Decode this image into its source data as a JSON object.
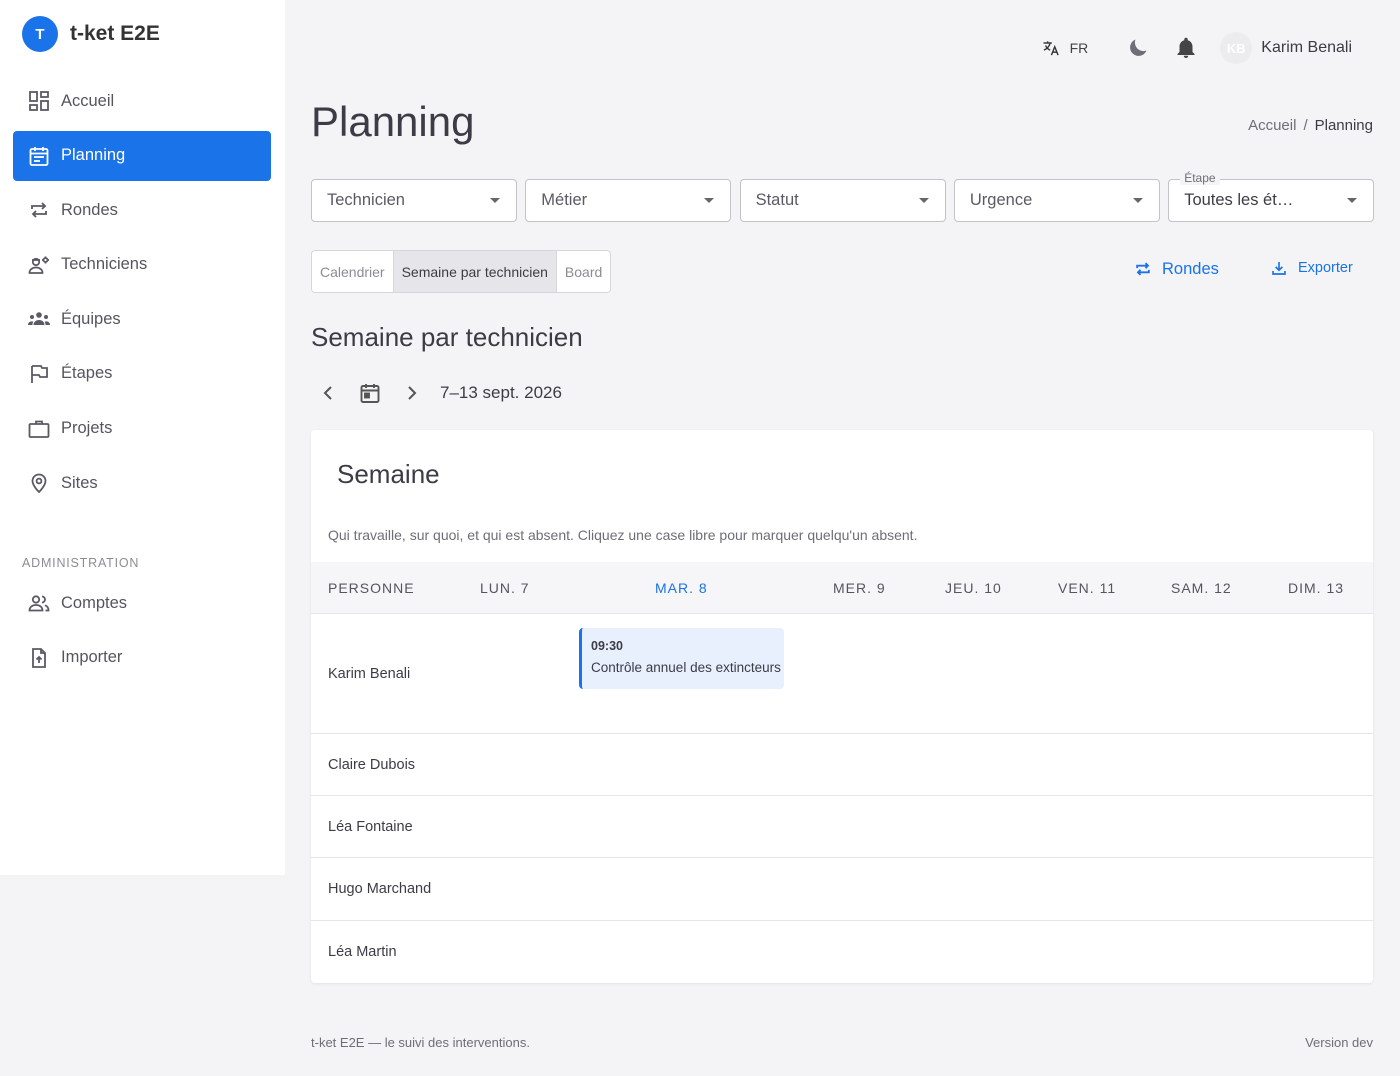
{
  "app": {
    "logo_letter": "T",
    "name": "t-ket E2E"
  },
  "sidebar": {
    "items": [
      {
        "label": "Accueil",
        "icon": "dashboard-icon"
      },
      {
        "label": "Planning",
        "icon": "calendar-icon",
        "active": true
      },
      {
        "label": "Rondes",
        "icon": "repeat-icon"
      },
      {
        "label": "Techniciens",
        "icon": "engineer-icon"
      },
      {
        "label": "Équipes",
        "icon": "groups-icon"
      },
      {
        "label": "Étapes",
        "icon": "flag-icon"
      },
      {
        "label": "Projets",
        "icon": "briefcase-icon"
      },
      {
        "label": "Sites",
        "icon": "location-pin-icon"
      }
    ],
    "admin_section": "ADMINISTRATION",
    "admin_items": [
      {
        "label": "Comptes",
        "icon": "people-icon"
      },
      {
        "label": "Importer",
        "icon": "file-upload-icon"
      }
    ]
  },
  "topbar": {
    "language": "FR",
    "user": {
      "initials": "KB",
      "name": "Karim Benali"
    }
  },
  "page": {
    "title": "Planning",
    "breadcrumb": [
      "Accueil",
      "Planning"
    ]
  },
  "filters": [
    {
      "label": "Technicien"
    },
    {
      "label": "Métier"
    },
    {
      "label": "Statut"
    },
    {
      "label": "Urgence"
    },
    {
      "label": "Étape",
      "value": "Toutes les ét…"
    }
  ],
  "views": [
    {
      "label": "Calendrier"
    },
    {
      "label": "Semaine par technicien",
      "active": true
    },
    {
      "label": "Board"
    }
  ],
  "actions": {
    "rondes": "Rondes",
    "export": "Exporter"
  },
  "section_title": "Semaine par technicien",
  "week": {
    "range": "7–13 sept. 2026"
  },
  "card": {
    "title": "Semaine",
    "subtitle": "Qui travaille, sur quoi, et qui est absent. Cliquez une case libre pour marquer quelqu'un absent.",
    "columns": [
      "PERSONNE",
      "LUN. 7",
      "MAR. 8",
      "MER. 9",
      "JEU. 10",
      "VEN. 11",
      "SAM. 12",
      "DIM. 13"
    ],
    "today_column": "MAR. 8",
    "rows": [
      {
        "name": "Karim Benali",
        "event": {
          "time": "09:30",
          "title": "Contrôle annuel des extincteurs",
          "day": "MAR. 8"
        }
      },
      {
        "name": "Claire Dubois"
      },
      {
        "name": "Léa Fontaine"
      },
      {
        "name": "Hugo Marchand"
      },
      {
        "name": "Léa Martin"
      }
    ]
  },
  "footer": {
    "left": "t-ket E2E — le suivi des interventions.",
    "right": "Version dev"
  },
  "colors": {
    "accent": "#1a73e8",
    "background": "#f4f4f6",
    "event_bg": "#e8f0fd"
  }
}
